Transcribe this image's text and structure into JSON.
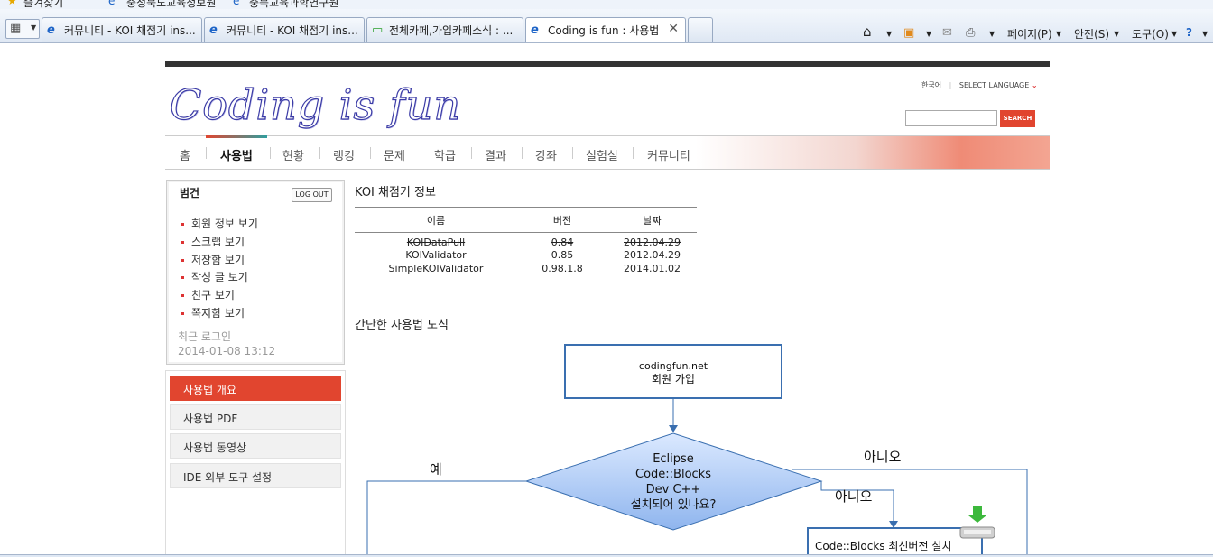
{
  "favorites_bar": {
    "items": [
      "즐겨찾기",
      "충청북도교육정보원",
      "충북교육과학연구원"
    ]
  },
  "tabs": [
    {
      "label": "커뮤니티 - KOI 채점기 ins..."
    },
    {
      "label": "커뮤니티 - KOI 채점기 ins..."
    },
    {
      "label": "전체카페,가입카페소식 : ..."
    },
    {
      "label": "Coding is fun : 사용법",
      "active": true
    }
  ],
  "toolbar": {
    "page_label": "페이지(P)",
    "safety_label": "안전(S)",
    "tools_label": "도구(O)"
  },
  "site": {
    "logo_text": "Coding is fun",
    "lang_current": "한국어",
    "lang_select": "SELECT LANGUAGE",
    "search_button": "SEARCH"
  },
  "nav": {
    "items": [
      "홈",
      "사용법",
      "현황",
      "랭킹",
      "문제",
      "학급",
      "결과",
      "강좌",
      "실험실",
      "커뮤니티"
    ],
    "current": "사용법"
  },
  "login_box": {
    "user": "범건",
    "logout_label": "LOG OUT",
    "items": [
      "회원 정보 보기",
      "스크랩 보기",
      "저장함 보기",
      "작성 글 보기",
      "친구 보기",
      "쪽지함 보기"
    ],
    "recent_label": "최근 로그인",
    "recent_time": "2014-01-08 13:12"
  },
  "side_menu": {
    "items": [
      "사용법 개요",
      "사용법 PDF",
      "사용법 동영상",
      "IDE 외부 도구 설정"
    ],
    "active_index": 0
  },
  "koi_info": {
    "title": "KOI 채점기 정보",
    "headers": [
      "이름",
      "버전",
      "날짜"
    ],
    "rows": [
      {
        "name": "KOIDataPull",
        "version": "0.84",
        "date": "2012.04.29",
        "deprecated": true
      },
      {
        "name": "KOIValidator",
        "version": "0.85",
        "date": "2012.04.29",
        "deprecated": true
      },
      {
        "name": "SimpleKOIValidator",
        "version": "0.98.1.8",
        "date": "2014.01.02",
        "deprecated": false
      }
    ]
  },
  "diagram": {
    "title": "간단한 사용법 도식",
    "start_box": {
      "line1": "codingfun.net",
      "line2": "회원 가입"
    },
    "decision": {
      "lines": [
        "Eclipse",
        "Code::Blocks",
        "Dev C++",
        "설치되어 있나요?"
      ]
    },
    "yes_label": "예",
    "no_label_1": "아니오",
    "no_label_2": "아니오",
    "install_box": "Code::Blocks 최신버전 설치"
  },
  "colors": {
    "accent": "#e1452f",
    "diagram_stroke": "#3a6fb0",
    "decision_fill": "#a9c8f5"
  }
}
